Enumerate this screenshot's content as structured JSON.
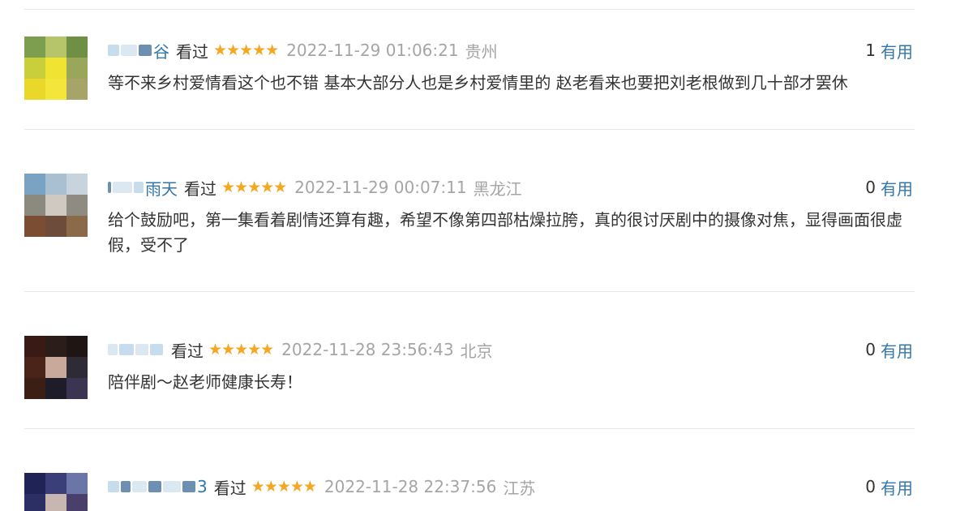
{
  "reviews": [
    {
      "user_suffix": "谷",
      "status": "看过",
      "stars": "★★★★★",
      "time": "2022-11-29 01:06:21",
      "location": "贵州",
      "useful_count": "1",
      "useful_label": "有用",
      "text": "等不来乡村爱情看这个也不错 基本大部分人也是乡村爱情里的 赵老看来也要把刘老根做到几十部才罢休"
    },
    {
      "user_suffix": "雨天",
      "status": "看过",
      "stars": "★★★★★",
      "time": "2022-11-29 00:07:11",
      "location": "黑龙江",
      "useful_count": "0",
      "useful_label": "有用",
      "text": "给个鼓励吧，第一集看着剧情还算有趣，希望不像第四部枯燥拉胯，真的很讨厌剧中的摄像对焦，显得画面很虚假，受不了"
    },
    {
      "user_suffix": "",
      "status": "看过",
      "stars": "★★★★★",
      "time": "2022-11-28 23:56:43",
      "location": "北京",
      "useful_count": "0",
      "useful_label": "有用",
      "text": "陪伴剧～赵老师健康长寿！"
    },
    {
      "user_suffix": "3",
      "status": "看过",
      "stars": "★★★★★",
      "time": "2022-11-28 22:37:56",
      "location": "江苏",
      "useful_count": "0",
      "useful_label": "有用",
      "text": ""
    }
  ],
  "colors": {
    "link": "#3377aa",
    "star": "#f5a623",
    "meta_gray": "#a5a5a5",
    "divider": "#e6e6e6"
  }
}
